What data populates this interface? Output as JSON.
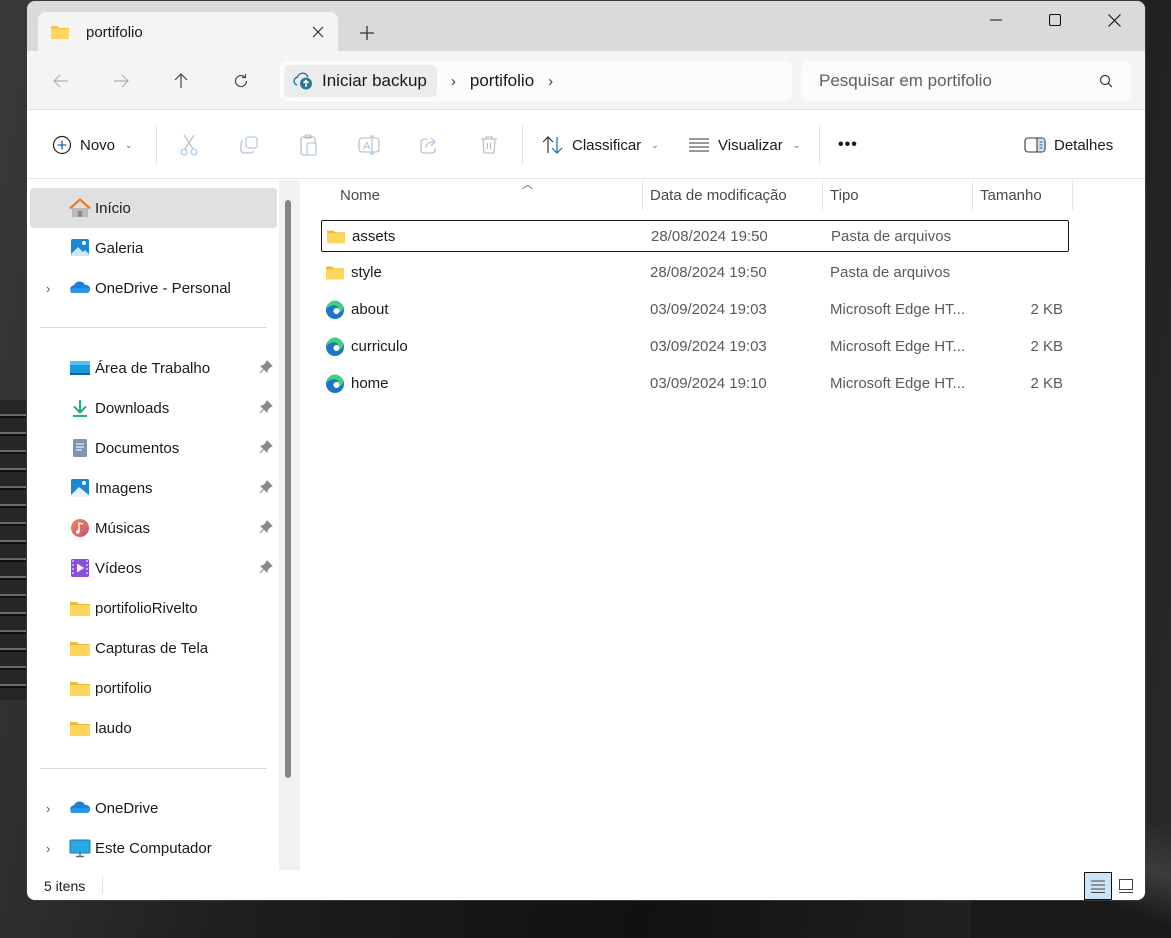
{
  "window": {
    "tab_title": "portifolio",
    "new_tab_label": "+",
    "controls": {
      "minimize": "minimize",
      "maximize": "maximize",
      "close": "close"
    }
  },
  "navigation": {
    "back": "back",
    "forward": "forward",
    "up": "up",
    "refresh": "refresh",
    "address": {
      "backup_chip": "Iniciar backup",
      "breadcrumbs": [
        "portifolio"
      ]
    },
    "search": {
      "placeholder": "Pesquisar em portifolio",
      "value": ""
    }
  },
  "commandbar": {
    "new_label": "Novo",
    "icons": [
      "cut",
      "copy",
      "paste",
      "rename",
      "share",
      "delete"
    ],
    "sort_label": "Classificar",
    "view_label": "Visualizar",
    "more_label": "•••",
    "details_label": "Detalhes"
  },
  "sidebar": {
    "top_items": [
      {
        "label": "Início",
        "icon": "home-icon",
        "selected": true
      },
      {
        "label": "Galeria",
        "icon": "gallery-icon"
      },
      {
        "label": "OneDrive - Personal",
        "icon": "onedrive-icon",
        "expandable": true
      }
    ],
    "pinned_items": [
      {
        "label": "Área de Trabalho",
        "icon": "desktop-icon",
        "pinned": true
      },
      {
        "label": "Downloads",
        "icon": "downloads-icon",
        "pinned": true
      },
      {
        "label": "Documentos",
        "icon": "documents-icon",
        "pinned": true
      },
      {
        "label": "Imagens",
        "icon": "pictures-icon",
        "pinned": true
      },
      {
        "label": "Músicas",
        "icon": "music-icon",
        "pinned": true
      },
      {
        "label": "Vídeos",
        "icon": "videos-icon",
        "pinned": true
      },
      {
        "label": "portifolioRivelto",
        "icon": "folder-icon"
      },
      {
        "label": "Capturas de Tela",
        "icon": "folder-icon"
      },
      {
        "label": "portifolio",
        "icon": "folder-icon"
      },
      {
        "label": "laudo",
        "icon": "folder-icon"
      }
    ],
    "bottom_items": [
      {
        "label": "OneDrive",
        "icon": "onedrive-icon",
        "expandable": true
      },
      {
        "label": "Este Computador",
        "icon": "computer-icon",
        "expandable": true
      }
    ]
  },
  "file_list": {
    "columns": [
      "Nome",
      "Data de modificação",
      "Tipo",
      "Tamanho"
    ],
    "sorted_by": "Nome",
    "rows": [
      {
        "name": "assets",
        "date": "28/08/2024 19:50",
        "type": "Pasta de arquivos",
        "size": "",
        "icon": "folder-icon",
        "focused": true
      },
      {
        "name": "style",
        "date": "28/08/2024 19:50",
        "type": "Pasta de arquivos",
        "size": "",
        "icon": "folder-icon"
      },
      {
        "name": "about",
        "date": "03/09/2024 19:03",
        "type": "Microsoft Edge HT...",
        "size": "2 KB",
        "icon": "edge-icon"
      },
      {
        "name": "curriculo",
        "date": "03/09/2024 19:03",
        "type": "Microsoft Edge HT...",
        "size": "2 KB",
        "icon": "edge-icon"
      },
      {
        "name": "home",
        "date": "03/09/2024 19:10",
        "type": "Microsoft Edge HT...",
        "size": "2 KB",
        "icon": "edge-icon"
      }
    ]
  },
  "statusbar": {
    "item_count": "5 itens",
    "view_modes": [
      "details",
      "large-icons"
    ],
    "active_view": "details"
  },
  "colors": {
    "accent": "#0067c0",
    "folder": "#f6c344",
    "selection": "#e0e0e0",
    "view_active": "#cce4f7"
  }
}
